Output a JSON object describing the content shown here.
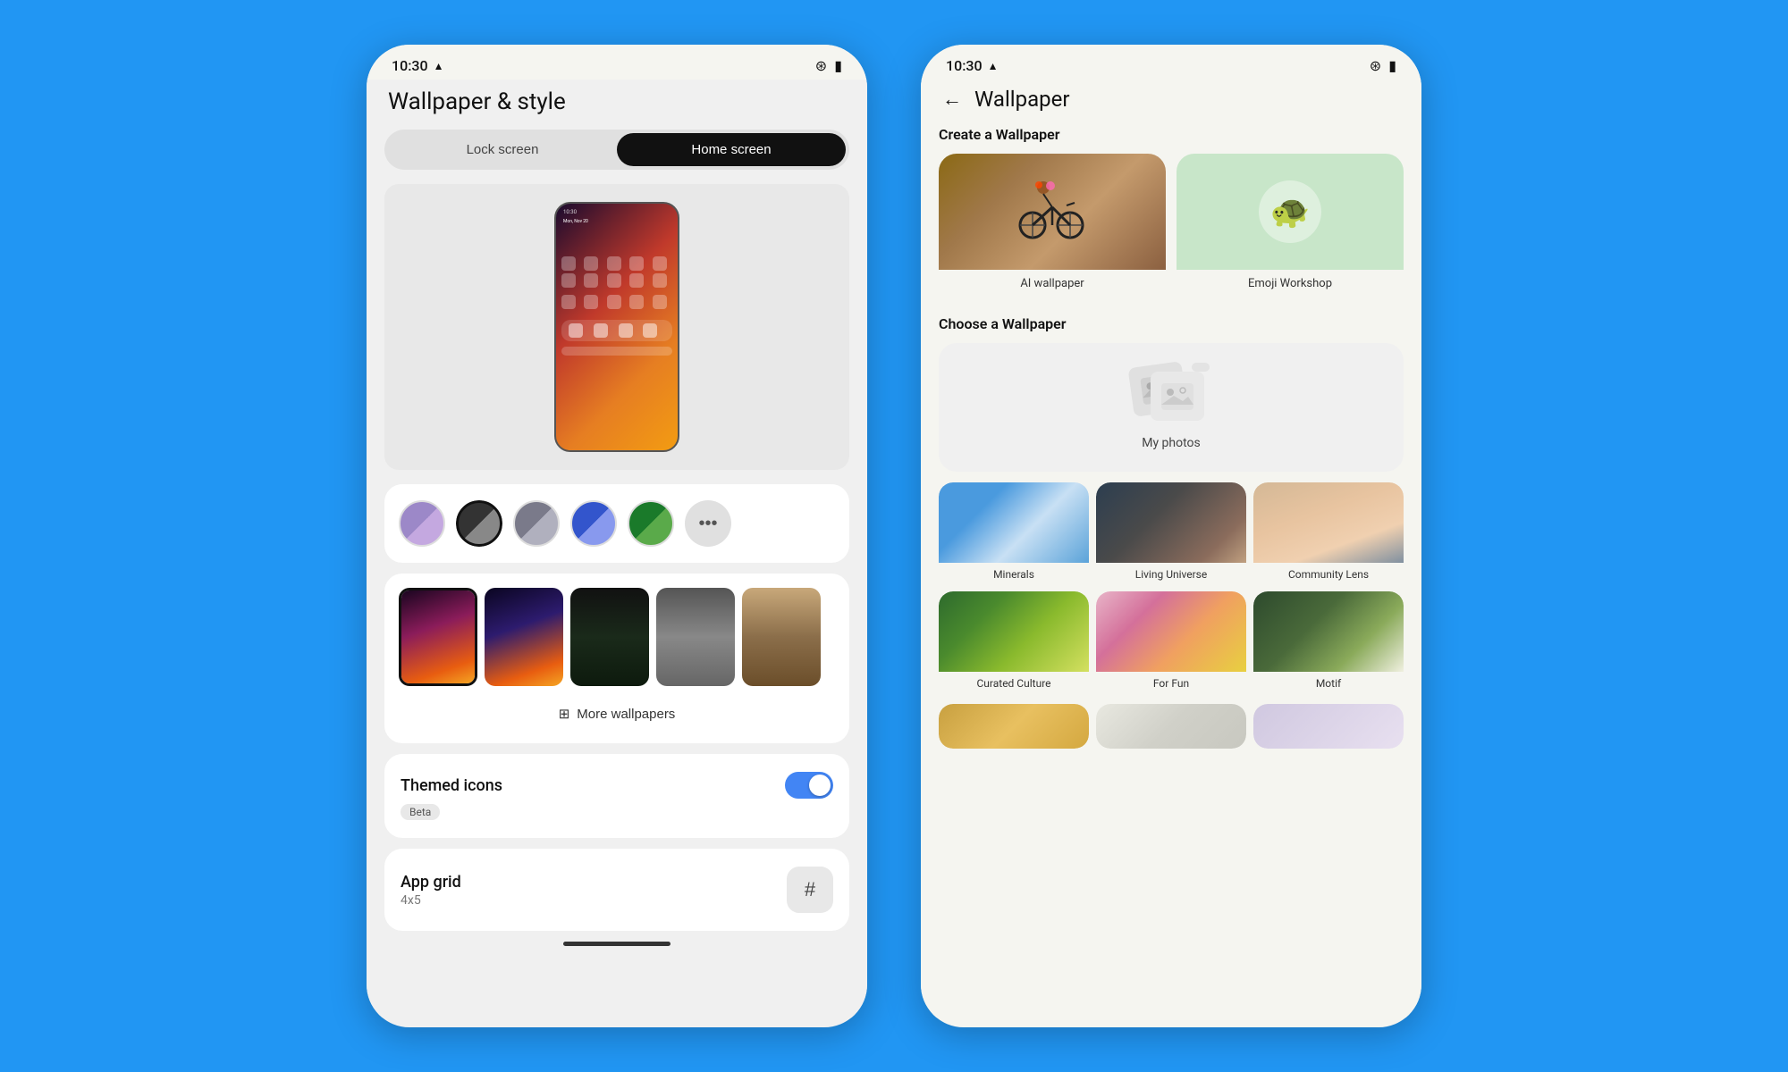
{
  "left_phone": {
    "status_time": "10:30",
    "status_icon_signal": "▲",
    "status_icon_wifi": "▾",
    "status_icon_battery": "▮",
    "page_title": "Wallpaper & style",
    "tabs": {
      "lock_screen": "Lock screen",
      "home_screen": "Home screen"
    },
    "colors": [
      {
        "id": "purple-gradient",
        "color1": "#9c88c8",
        "color2": "#c4a8e0",
        "selected": false
      },
      {
        "id": "dark-circle",
        "color1": "#333",
        "color2": "#555",
        "selected": true
      },
      {
        "id": "gray-circle",
        "color1": "#7a7a8a",
        "color2": "#9a9aaa",
        "selected": false
      },
      {
        "id": "blue-circle",
        "color1": "#3355cc",
        "color2": "#5577ee",
        "selected": false
      },
      {
        "id": "green-circle",
        "color1": "#1a7a2a",
        "color2": "#3a9a4a",
        "selected": false
      }
    ],
    "more_colors_label": "···",
    "wallpapers": [
      {
        "id": "wp1",
        "selected": true
      },
      {
        "id": "wp2",
        "selected": false
      },
      {
        "id": "wp3",
        "selected": false
      },
      {
        "id": "wp4",
        "selected": false
      },
      {
        "id": "wp5",
        "selected": false
      }
    ],
    "more_wallpapers_label": "More wallpapers",
    "themed_icons_label": "Themed icons",
    "beta_label": "Beta",
    "themed_icons_enabled": true,
    "app_grid_label": "App grid",
    "app_grid_size": "4x5"
  },
  "right_phone": {
    "status_time": "10:30",
    "back_arrow": "←",
    "page_title": "Wallpaper",
    "create_section_header": "Create a Wallpaper",
    "create_options": [
      {
        "id": "ai-wallpaper",
        "label": "AI wallpaper"
      },
      {
        "id": "emoji-workshop",
        "label": "Emoji Workshop"
      }
    ],
    "choose_section_header": "Choose a Wallpaper",
    "my_photos_label": "My photos",
    "wallpaper_categories": [
      {
        "id": "minerals",
        "label": "Minerals"
      },
      {
        "id": "living-universe",
        "label": "Living Universe"
      },
      {
        "id": "community-lens",
        "label": "Community Lens"
      },
      {
        "id": "curated-culture",
        "label": "Curated Culture"
      },
      {
        "id": "for-fun",
        "label": "For Fun"
      },
      {
        "id": "motif",
        "label": "Motif"
      }
    ]
  }
}
